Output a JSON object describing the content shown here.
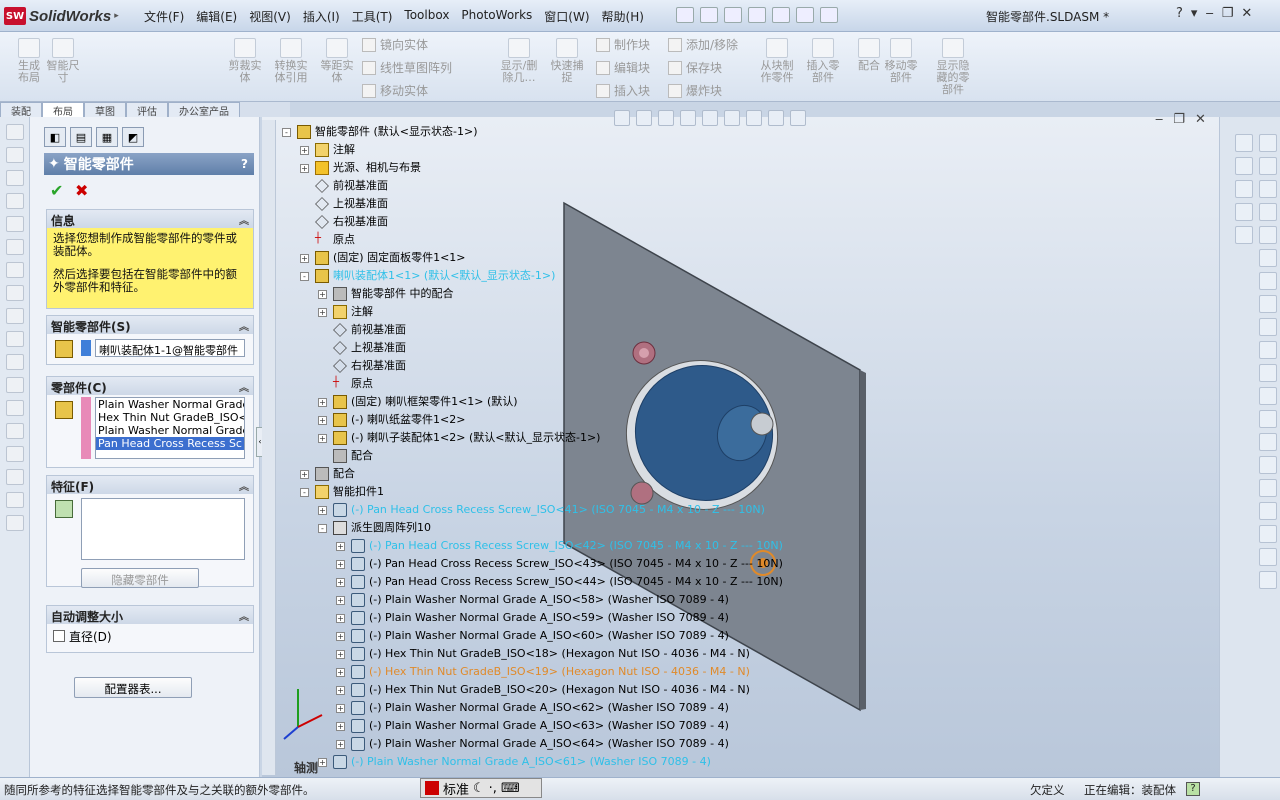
{
  "app": {
    "name": "SolidWorks",
    "logo_text": "SW",
    "doc_title": "智能零部件.SLDASM *"
  },
  "menus": [
    "文件(F)",
    "编辑(E)",
    "视图(V)",
    "插入(I)",
    "工具(T)",
    "Toolbox",
    "PhotoWorks",
    "窗口(W)",
    "帮助(H)"
  ],
  "ribbon": {
    "big": [
      "生成\n布局",
      "智能尺\n寸",
      "剪裁实\n体",
      "转换实\n体引用",
      "等距实\n体",
      "显示/删\n除几…",
      "快速捕\n捉",
      "从块制\n作零件",
      "插入零\n部件",
      "配合",
      "移动零\n部件",
      "显示隐\n藏的零\n部件"
    ],
    "small": [
      "镜向实体",
      "线性草图阵列",
      "移动实体",
      "制作块",
      "编辑块",
      "插入块",
      "添加/移除",
      "保存块",
      "爆炸块"
    ]
  },
  "tabs": [
    "装配",
    "布局",
    "草图",
    "评估",
    "办公室产品"
  ],
  "pm": {
    "title": "智能零部件",
    "help": "?",
    "info_title": "信息",
    "info_text1": "选择您想制作成智能零部件的零件或装配体。",
    "info_text2": "然后选择要包括在智能零部件中的额外零部件和特征。",
    "smart_title": "智能零部件(S)",
    "smart_value": "喇叭装配体1-1@智能零部件",
    "comp_title": "零部件(C)",
    "comp_items": [
      "Plain Washer Normal Grade",
      "Hex Thin Nut GradeB_ISO<",
      "Plain Washer Normal Grade",
      "Pan Head Cross Recess Sc"
    ],
    "feat_title": "特征(F)",
    "hide_btn": "隐藏零部件",
    "auto_title": "自动调整大小",
    "diameter": "直径(D)",
    "config_btn": "配置器表..."
  },
  "tree": [
    {
      "t": "智能零部件 (默认<显示状态-1>)",
      "lvl": 0,
      "i": "asm",
      "pm": "-"
    },
    {
      "t": "注解",
      "lvl": 1,
      "i": "note",
      "pm": "+"
    },
    {
      "t": "光源、相机与布景",
      "lvl": 1,
      "i": "light",
      "pm": "+"
    },
    {
      "t": "前视基准面",
      "lvl": 1,
      "i": "plane",
      "pm": ""
    },
    {
      "t": "上视基准面",
      "lvl": 1,
      "i": "plane",
      "pm": ""
    },
    {
      "t": "右视基准面",
      "lvl": 1,
      "i": "plane",
      "pm": ""
    },
    {
      "t": "原点",
      "lvl": 1,
      "i": "orig",
      "pm": ""
    },
    {
      "t": "(固定) 固定面板零件1<1>",
      "lvl": 1,
      "i": "asm",
      "pm": "+"
    },
    {
      "t": "喇叭装配体1<1> (默认<默认_显示状态-1>)",
      "lvl": 1,
      "i": "asm",
      "pm": "-",
      "c": "cyan"
    },
    {
      "t": "智能零部件 中的配合",
      "lvl": 2,
      "i": "mate",
      "pm": "+"
    },
    {
      "t": "注解",
      "lvl": 2,
      "i": "note",
      "pm": "+"
    },
    {
      "t": "前视基准面",
      "lvl": 2,
      "i": "plane",
      "pm": ""
    },
    {
      "t": "上视基准面",
      "lvl": 2,
      "i": "plane",
      "pm": ""
    },
    {
      "t": "右视基准面",
      "lvl": 2,
      "i": "plane",
      "pm": ""
    },
    {
      "t": "原点",
      "lvl": 2,
      "i": "orig",
      "pm": ""
    },
    {
      "t": "(固定) 喇叭框架零件1<1> (默认)",
      "lvl": 2,
      "i": "asm",
      "pm": "+"
    },
    {
      "t": "(-) 喇叭纸盆零件1<2>",
      "lvl": 2,
      "i": "asm",
      "pm": "+"
    },
    {
      "t": "(-) 喇叭子装配体1<2> (默认<默认_显示状态-1>)",
      "lvl": 2,
      "i": "asm",
      "pm": "+"
    },
    {
      "t": "配合",
      "lvl": 2,
      "i": "mate",
      "pm": ""
    },
    {
      "t": "配合",
      "lvl": 1,
      "i": "mate",
      "pm": "+"
    },
    {
      "t": "智能扣件1",
      "lvl": 1,
      "i": "note",
      "pm": "-"
    },
    {
      "t": "(-) Pan Head Cross Recess Screw_ISO<41> (ISO 7045 - M4 x 10 - Z --- 10N)",
      "lvl": 2,
      "i": "screw",
      "pm": "+",
      "c": "cyan"
    },
    {
      "t": "派生圆周阵列10",
      "lvl": 2,
      "i": "pattern",
      "pm": "-"
    },
    {
      "t": "(-) Pan Head Cross Recess Screw_ISO<42> (ISO 7045 - M4 x 10 - Z --- 10N)",
      "lvl": 3,
      "i": "screw",
      "pm": "+",
      "c": "cyan"
    },
    {
      "t": "(-) Pan Head Cross Recess Screw_ISO<43> (ISO 7045 - M4 x 10 - Z --- 10N)",
      "lvl": 3,
      "i": "screw",
      "pm": "+"
    },
    {
      "t": "(-) Pan Head Cross Recess Screw_ISO<44> (ISO 7045 - M4 x 10 - Z --- 10N)",
      "lvl": 3,
      "i": "screw",
      "pm": "+"
    },
    {
      "t": "(-) Plain Washer Normal Grade A_ISO<58> (Washer ISO 7089 - 4)",
      "lvl": 3,
      "i": "screw",
      "pm": "+"
    },
    {
      "t": "(-) Plain Washer Normal Grade A_ISO<59> (Washer ISO 7089 - 4)",
      "lvl": 3,
      "i": "screw",
      "pm": "+"
    },
    {
      "t": "(-) Plain Washer Normal Grade A_ISO<60> (Washer ISO 7089 - 4)",
      "lvl": 3,
      "i": "screw",
      "pm": "+"
    },
    {
      "t": "(-) Hex Thin Nut GradeB_ISO<18> (Hexagon Nut ISO - 4036 - M4 - N)",
      "lvl": 3,
      "i": "screw",
      "pm": "+"
    },
    {
      "t": "(-) Hex Thin Nut GradeB_ISO<19> (Hexagon Nut ISO - 4036 - M4 - N)",
      "lvl": 3,
      "i": "screw",
      "pm": "+",
      "c": "orange"
    },
    {
      "t": "(-) Hex Thin Nut GradeB_ISO<20> (Hexagon Nut ISO - 4036 - M4 - N)",
      "lvl": 3,
      "i": "screw",
      "pm": "+"
    },
    {
      "t": "(-) Plain Washer Normal Grade A_ISO<62> (Washer ISO 7089 - 4)",
      "lvl": 3,
      "i": "screw",
      "pm": "+"
    },
    {
      "t": "(-) Plain Washer Normal Grade A_ISO<63> (Washer ISO 7089 - 4)",
      "lvl": 3,
      "i": "screw",
      "pm": "+"
    },
    {
      "t": "(-) Plain Washer Normal Grade A_ISO<64> (Washer ISO 7089 - 4)",
      "lvl": 3,
      "i": "screw",
      "pm": "+"
    },
    {
      "t": "(-) Plain Washer Normal Grade A_ISO<61> (Washer ISO 7089 - 4)",
      "lvl": 2,
      "i": "screw",
      "pm": "+",
      "c": "cyan"
    }
  ],
  "view_label": "轴测",
  "status": {
    "hint": "随同所参考的特征选择智能零部件及与之关联的额外零部件。",
    "ime": "标准",
    "undefined": "欠定义",
    "editing": "正在编辑：装配体",
    "help": "?"
  },
  "colors": {
    "panel": "#eef2f8",
    "info_bg": "#fff270",
    "accent": "#5f7fa9",
    "cyan_text": "#2fc0e8",
    "orange_text": "#e08a2a",
    "plate": "#7d8590",
    "speaker": "#2e5a8a"
  }
}
